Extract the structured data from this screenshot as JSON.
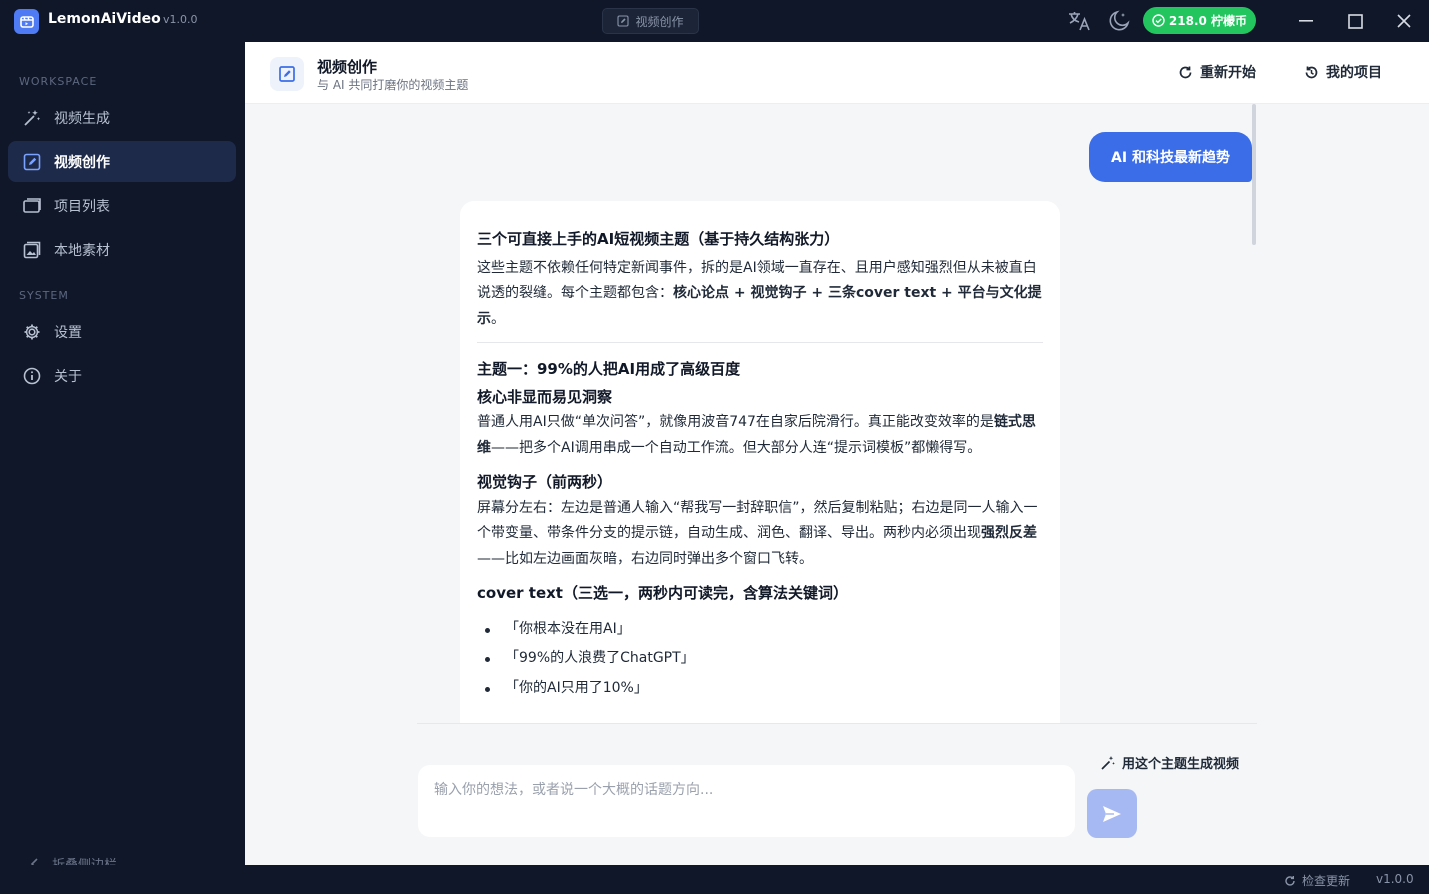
{
  "titlebar": {
    "app_name": "LemonAiVideo",
    "version": "v1.0.0",
    "tab_label": "视频创作",
    "coins": "218.0 柠檬币"
  },
  "sidebar": {
    "workspace_label": "WORKSPACE",
    "system_label": "SYSTEM",
    "workspace_items": [
      {
        "label": "视频生成",
        "icon": "magic-wand-icon"
      },
      {
        "label": "视频创作",
        "icon": "edit-square-icon",
        "active": true
      },
      {
        "label": "项目列表",
        "icon": "folder-icon"
      },
      {
        "label": "本地素材",
        "icon": "image-icon"
      }
    ],
    "system_items": [
      {
        "label": "设置",
        "icon": "gear-icon"
      },
      {
        "label": "关于",
        "icon": "info-icon"
      }
    ],
    "collapse_label": "折叠侧边栏"
  },
  "header": {
    "title": "视频创作",
    "subtitle": "与 AI 共同打磨你的视频主题",
    "restart_label": "重新开始",
    "projects_label": "我的项目"
  },
  "chat": {
    "user_message": "AI 和科技最新趋势",
    "ai": {
      "title": "三个可直接上手的AI短视频主题（基于持久结构张力）",
      "intro_a": "这些主题不依赖任何特定新闻事件，拆的是AI领域一直存在、且用户感知强烈但从未被直白说透的裂缝。每个主题都包含：",
      "intro_b": "核心论点 + 视觉钩子 + 三条cover text + 平台与文化提示",
      "intro_c": "。",
      "theme1_title": "主题一：99%的人把AI用成了高级百度",
      "insight_title": "核心非显而易见洞察",
      "insight_a": "普通人用AI只做“单次问答”，就像用波音747在自家后院滑行。真正能改变效率的是",
      "insight_b": "链式思维",
      "insight_c": "——把多个AI调用串成一个自动工作流。但大部分人连“提示词模板”都懒得写。",
      "hook_title": "视觉钩子（前两秒）",
      "hook_a": "屏幕分左右：左边是普通人输入“帮我写一封辞职信”，然后复制粘贴；右边是同一人输入一个带变量、带条件分支的提示链，自动生成、润色、翻译、导出。两秒内必须出现",
      "hook_b": "强烈反差",
      "hook_c": "——比如左边画面灰暗，右边同时弹出多个窗口飞转。",
      "cover_title": "cover text（三选一，两秒内可读完，含算法关键词）",
      "cover_items": [
        "「你根本没在用AI」",
        "「99%的人浪费了ChatGPT」",
        "「你的AI只用了10%」"
      ]
    }
  },
  "composer": {
    "generate_label": "用这个主题生成视频",
    "placeholder": "输入你的想法，或者说一个大概的话题方向..."
  },
  "statusbar": {
    "update_label": "检查更新",
    "version": "v1.0.0"
  },
  "colors": {
    "accent": "#3b6de8",
    "coin_badge": "#22c55e",
    "sidebar_bg": "#0f1729",
    "active_item_bg": "#1e2a4a"
  }
}
